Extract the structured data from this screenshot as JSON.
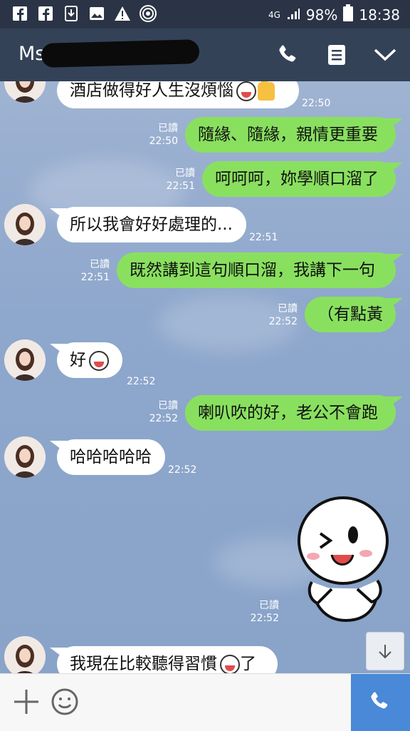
{
  "status_bar": {
    "icons": [
      "facebook-icon",
      "facebook-icon",
      "download-icon",
      "image-icon",
      "warning-icon",
      "hotspot-icon"
    ],
    "network": "4G",
    "battery": "98%",
    "time": "18:38"
  },
  "header": {
    "contact_name": "Ms",
    "icons": [
      "phone-icon",
      "notes-icon",
      "chevron-down-icon"
    ]
  },
  "messages": [
    {
      "side": "in",
      "text": "酒店做得好人生沒煩惱",
      "emoji": [
        "grin-emoji",
        "thumbs-up-emoji"
      ],
      "time": "22:50"
    },
    {
      "side": "out",
      "text": "隨緣、隨緣，親情更重要",
      "read": "已讀",
      "time": "22:50"
    },
    {
      "side": "out",
      "text": "呵呵呵，妳學順口溜了",
      "read": "已讀",
      "time": "22:51"
    },
    {
      "side": "in",
      "text": "所以我會好好處理的...",
      "time": "22:51"
    },
    {
      "side": "out",
      "text": "既然講到這句順口溜，我講下一句",
      "read": "已讀",
      "time": "22:51"
    },
    {
      "side": "out",
      "text": "（有點黃",
      "read": "已讀",
      "time": "22:52"
    },
    {
      "side": "in",
      "text": "好",
      "emoji": [
        "grin-emoji"
      ],
      "time": "22:52"
    },
    {
      "side": "out",
      "text": "喇叭吹的好，老公不會跑",
      "read": "已讀",
      "time": "22:52"
    },
    {
      "side": "in",
      "text": "哈哈哈哈哈",
      "time": "22:52"
    },
    {
      "side": "out",
      "type": "sticker",
      "sticker": "winking-character-sticker",
      "read": "已讀",
      "time": "22:52"
    },
    {
      "side": "in",
      "text": "我現在比較聽得習慣",
      "emoji": [
        "grimace-emoji"
      ],
      "text_after": "了"
    }
  ],
  "input_bar": {
    "add_icon": "plus-icon",
    "emoji_icon": "smiley-icon",
    "call_icon": "phone-icon"
  },
  "colors": {
    "status_bar": "#2b3446",
    "header": "#344258",
    "chat_bg": "#8ea7cc",
    "outgoing": "#89e05f",
    "incoming": "#ffffff",
    "call_button": "#4a88d8"
  }
}
